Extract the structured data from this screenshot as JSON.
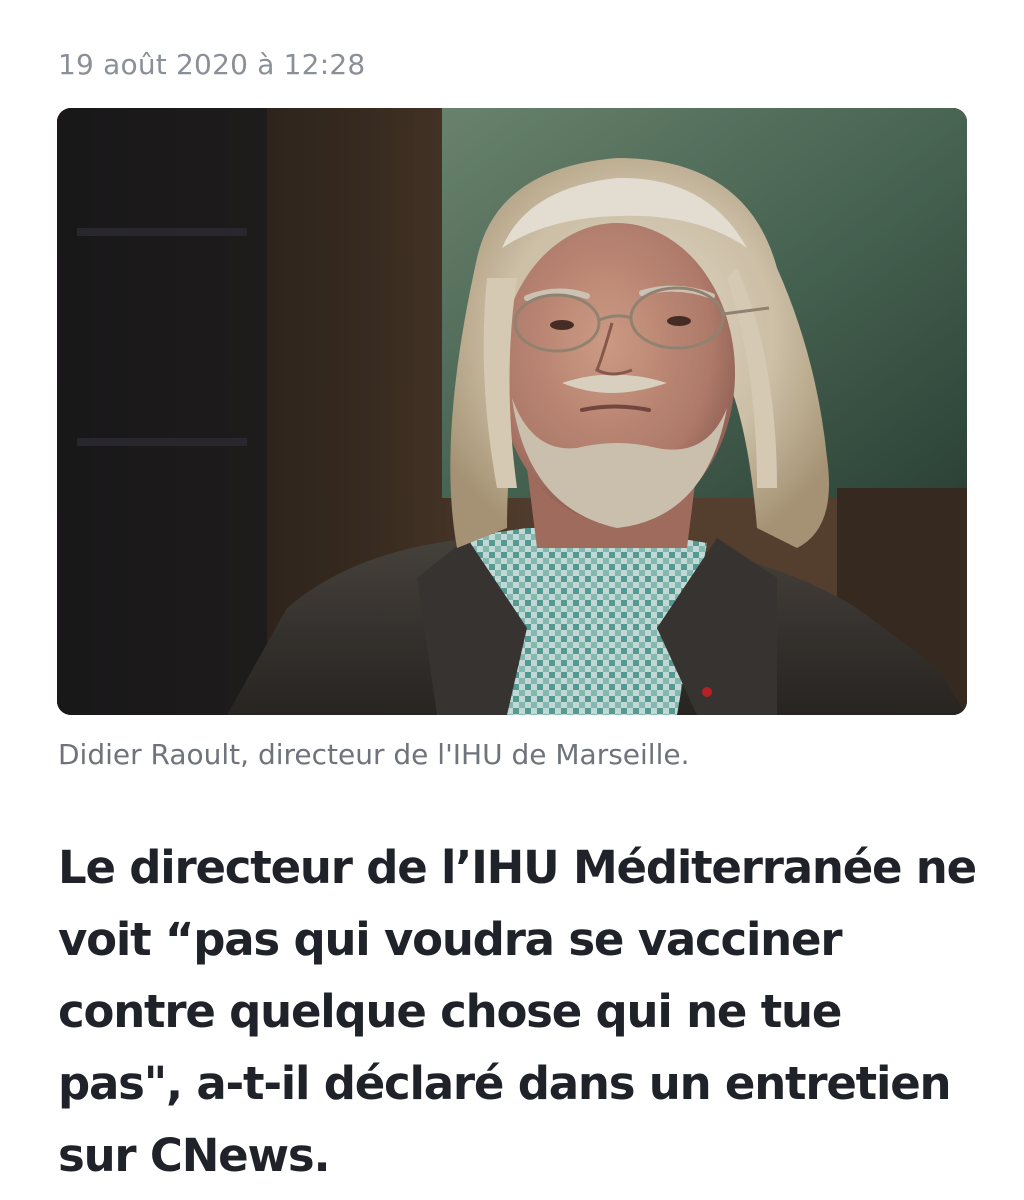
{
  "article": {
    "timestamp": "19 août 2020 à 12:28",
    "image": {
      "subject": "portrait-photo"
    },
    "caption": "Didier Raoult, directeur de l'IHU de Marseille.",
    "headline": "Le directeur de l’IHU Méditerranée ne voit “pas qui voudra se vacciner contre quelque chose qui ne tue pas\", a-t-il déclaré dans un entretien sur CNews."
  },
  "colors": {
    "timestamp": "#8a8f98",
    "caption": "#6f747c",
    "headline": "#1f2329",
    "background": "#ffffff"
  }
}
